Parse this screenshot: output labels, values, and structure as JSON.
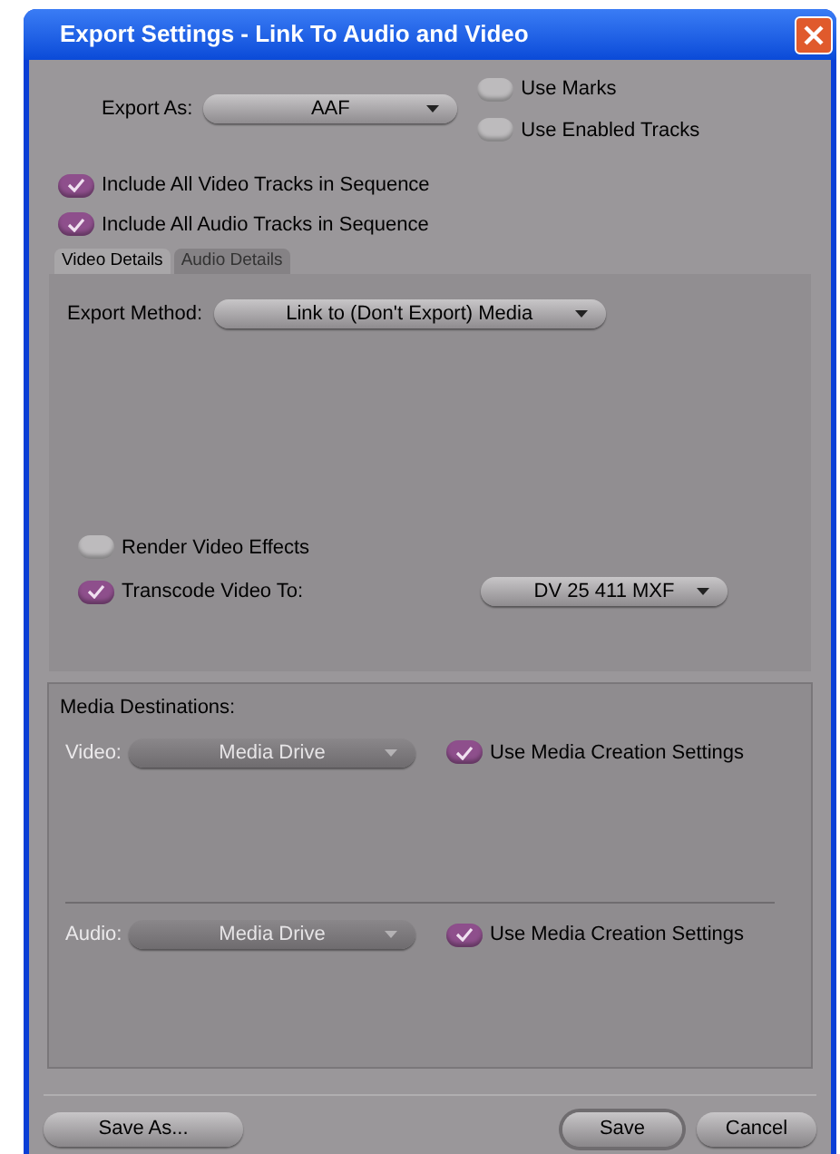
{
  "window": {
    "title": "Export Settings - Link To Audio and Video"
  },
  "export_as": {
    "label": "Export As:",
    "value": "AAF"
  },
  "use_options": [
    {
      "label": "Use Marks",
      "checked": false
    },
    {
      "label": "Use Enabled Tracks",
      "checked": false
    }
  ],
  "include_options": [
    {
      "label": "Include All Video Tracks in Sequence",
      "checked": true
    },
    {
      "label": "Include All Audio Tracks in Sequence",
      "checked": true
    }
  ],
  "tabs": [
    {
      "label": "Video Details",
      "selected": true
    },
    {
      "label": "Audio Details",
      "selected": false
    }
  ],
  "video_details": {
    "export_method": {
      "label": "Export Method:",
      "value": "Link to (Don't Export) Media"
    },
    "render_effects": {
      "label": "Render Video Effects",
      "checked": false
    },
    "transcode": {
      "label": "Transcode Video To:",
      "checked": true,
      "value": "DV 25 411  MXF"
    }
  },
  "media_destinations": {
    "title": "Media Destinations:",
    "rows": [
      {
        "label": "Video:",
        "value": "Media Drive",
        "disabled": true,
        "use_settings": {
          "label": "Use Media Creation Settings",
          "checked": true
        }
      },
      {
        "label": "Audio:",
        "value": "Media Drive",
        "disabled": true,
        "use_settings": {
          "label": "Use Media Creation Settings",
          "checked": true
        }
      }
    ]
  },
  "buttons": [
    {
      "label": "Save As...",
      "default": false
    },
    {
      "label": "Save",
      "default": true
    },
    {
      "label": "Cancel",
      "default": false
    }
  ]
}
